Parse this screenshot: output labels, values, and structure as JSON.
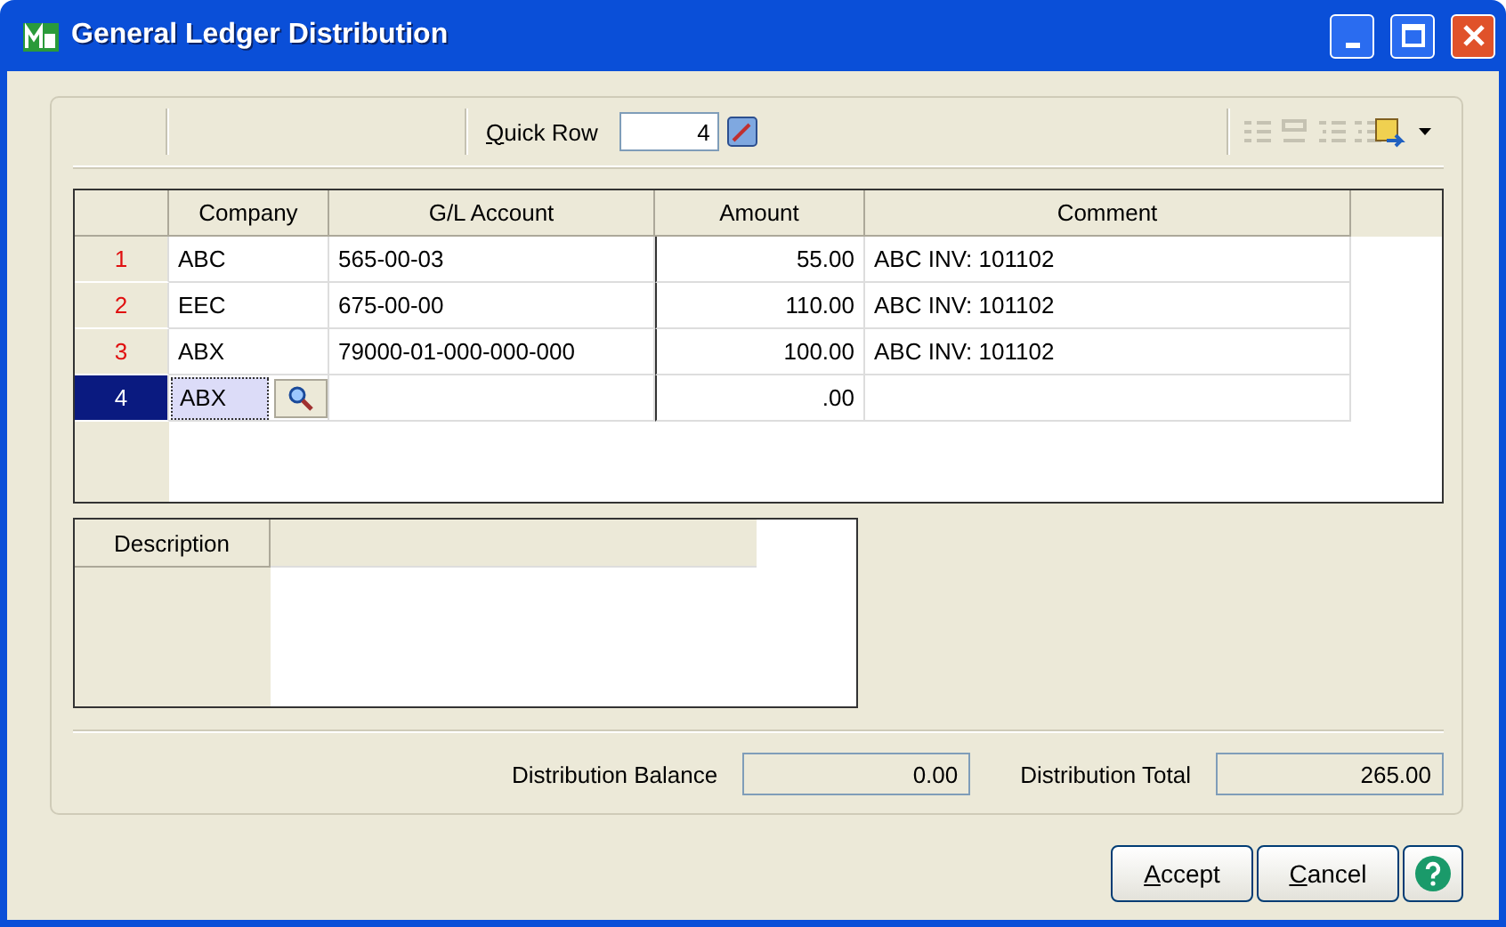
{
  "window": {
    "title": "General Ledger Distribution"
  },
  "toolbar": {
    "quick_row": {
      "label": "Quick Row",
      "mnemonic_first": true,
      "value": "4"
    }
  },
  "grid": {
    "columns": [
      "Company",
      "G/L Account",
      "Amount",
      "Comment"
    ],
    "rows": [
      {
        "number": "1",
        "company": "ABC",
        "account": "565-00-03",
        "amount": "55.00",
        "comment": "ABC  INV: 101102",
        "selected": false
      },
      {
        "number": "2",
        "company": "EEC",
        "account": "675-00-00",
        "amount": "110.00",
        "comment": "ABC  INV: 101102",
        "selected": false
      },
      {
        "number": "3",
        "company": "ABX",
        "account": "79000-01-000-000-000",
        "amount": "100.00",
        "comment": "ABC  INV: 101102",
        "selected": false
      },
      {
        "number": "4",
        "company": "ABX",
        "account": "",
        "amount": ".00",
        "comment": "",
        "selected": true
      }
    ]
  },
  "description": {
    "label": "Description"
  },
  "totals": [
    {
      "label": "Distribution Balance",
      "value": "0.00"
    },
    {
      "label": "Distribution Total",
      "value": "265.00"
    }
  ],
  "buttons": [
    {
      "label": "Accept",
      "mnemonic_first": true
    },
    {
      "label": "Cancel",
      "mnemonic_first": true
    }
  ]
}
